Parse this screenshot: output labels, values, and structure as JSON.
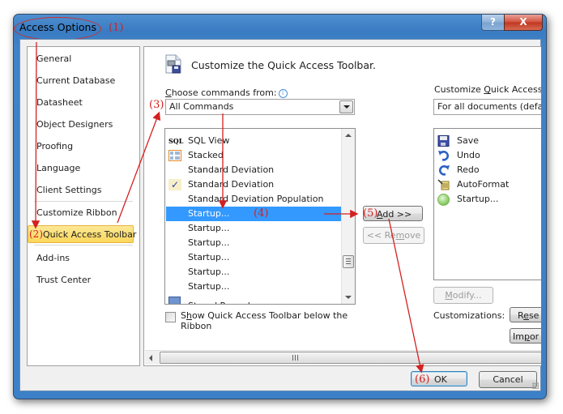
{
  "window": {
    "title": "Access Options",
    "help_label": "?",
    "close_label": "X"
  },
  "annotations": {
    "step1": "(1)",
    "step2": "(2)",
    "step3": "(3)",
    "step4": "(4)",
    "step5": "(5)",
    "step6": "(6)",
    "color": "#d42020"
  },
  "sidebar": {
    "items": [
      {
        "label": "General"
      },
      {
        "label": "Current Database"
      },
      {
        "label": "Datasheet"
      },
      {
        "label": "Object Designers"
      },
      {
        "label": "Proofing"
      },
      {
        "label": "Language"
      },
      {
        "label": "Client Settings"
      },
      {
        "label": "Customize Ribbon"
      },
      {
        "label": "Quick Access Toolbar",
        "selected": true
      },
      {
        "label": "Add-ins"
      },
      {
        "label": "Trust Center"
      }
    ]
  },
  "main": {
    "header": "Customize the Quick Access Toolbar.",
    "choose_label_prefix": "C",
    "choose_label_rest": "hoose commands from:",
    "info_icon": "i",
    "commands_source": "All Commands",
    "commands": [
      {
        "label": "SQL View",
        "icon": "sql-icon",
        "icon_text": "SQL"
      },
      {
        "label": "Stacked",
        "icon": "stacked-layout-icon"
      },
      {
        "label": "Standard Deviation",
        "icon": ""
      },
      {
        "label": "Standard Deviation",
        "icon": "checkmark-icon",
        "icon_text": "✓"
      },
      {
        "label": "Standard Deviation Population",
        "icon": ""
      },
      {
        "label": "Startup...",
        "icon": "",
        "selected": true
      },
      {
        "label": "Startup...",
        "icon": ""
      },
      {
        "label": "Startup...",
        "icon": ""
      },
      {
        "label": "Startup...",
        "icon": ""
      },
      {
        "label": "Startup...",
        "icon": ""
      },
      {
        "label": "Startup...",
        "icon": ""
      },
      {
        "label": "Stored Procedure",
        "icon": "stored-procedure-icon"
      }
    ],
    "add_prefix": "A",
    "add_rest": "dd >>",
    "remove_prefix": "<< Re",
    "remove_u": "m",
    "remove_rest": "ove",
    "show_below_prefix": "S",
    "show_below_u": "h",
    "show_below_rest": "ow Quick Access Toolbar below the",
    "show_below_line2": "Ribbon",
    "show_below_checked": false,
    "customize_label_prefix": "Customize ",
    "customize_label_u": "Q",
    "customize_label_rest": "uick Access T",
    "customize_for": "For all documents (defau",
    "toolbar_items": [
      {
        "label": "Save",
        "icon": "save-icon"
      },
      {
        "label": "Undo",
        "icon": "undo-icon"
      },
      {
        "label": "Redo",
        "icon": "redo-icon"
      },
      {
        "label": "AutoFormat",
        "icon": "autoformat-icon"
      },
      {
        "label": "Startup...",
        "icon": "startup-icon"
      }
    ],
    "modify_u": "M",
    "modify_rest": "odify...",
    "customizations_label": "Customizations:",
    "reset_prefix": "R",
    "reset_u": "e",
    "reset_rest": "se",
    "import_prefix": "Im",
    "import_u": "p",
    "import_rest": "or"
  },
  "footer": {
    "ok_label": "OK",
    "cancel_label": "Cancel"
  }
}
